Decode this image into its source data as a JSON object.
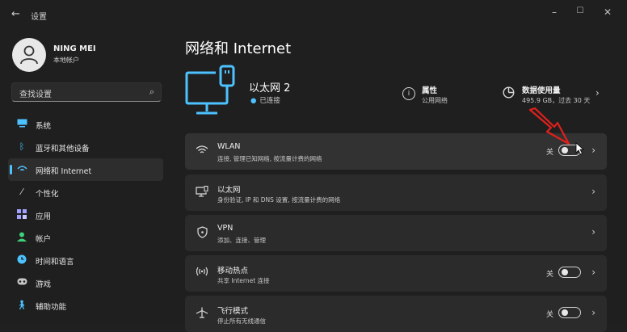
{
  "window": {
    "back_glyph": "←",
    "title": "设置",
    "minimize": "–",
    "maximize": "☐",
    "close": "✕"
  },
  "user": {
    "name": "NING MEI",
    "account_type": "本地帐户"
  },
  "search": {
    "placeholder": "查找设置"
  },
  "sidebar": {
    "items": [
      {
        "label": "系统",
        "icon": "monitor-icon",
        "color": "#4cc2ff"
      },
      {
        "label": "蓝牙和其他设备",
        "icon": "bluetooth-icon",
        "color": "#4cc2ff"
      },
      {
        "label": "网络和 Internet",
        "icon": "network-icon",
        "color": "#4cc2ff",
        "active": true
      },
      {
        "label": "个性化",
        "icon": "brush-icon",
        "color": "#d8d8d8"
      },
      {
        "label": "应用",
        "icon": "apps-icon",
        "color": "#a0a0ff"
      },
      {
        "label": "帐户",
        "icon": "person-icon",
        "color": "#3ed07a"
      },
      {
        "label": "时间和语言",
        "icon": "globe-clock-icon",
        "color": "#4cc2ff"
      },
      {
        "label": "游戏",
        "icon": "gamepad-icon",
        "color": "#c8c8c8"
      },
      {
        "label": "辅助功能",
        "icon": "accessibility-icon",
        "color": "#4cc2ff"
      }
    ]
  },
  "main": {
    "title": "网络和 Internet",
    "ethernet": {
      "name": "以太网 2",
      "status": "已连接"
    },
    "properties": {
      "title": "属性",
      "subtitle": "公用网络"
    },
    "data_usage": {
      "title": "数据使用量",
      "subtitle": "495.9 GB，过去 30 天"
    },
    "cards": [
      {
        "title": "WLAN",
        "subtitle": "连接, 管理已知网络, 按流量计费的网络",
        "icon": "wifi-icon",
        "toggle": "关"
      },
      {
        "title": "以太网",
        "subtitle": "身份验证, IP 和 DNS 设置, 按流量计费的网络",
        "icon": "ethernet-icon"
      },
      {
        "title": "VPN",
        "subtitle": "添加、连接、管理",
        "icon": "shield-icon"
      },
      {
        "title": "移动热点",
        "subtitle": "共享 Internet 连接",
        "icon": "hotspot-icon",
        "toggle": "关"
      },
      {
        "title": "飞行模式",
        "subtitle": "停止所有无线通信",
        "icon": "airplane-icon",
        "toggle": "关"
      }
    ]
  },
  "colors": {
    "accent": "#4cc2ff",
    "annotation_arrow": "#e0201c"
  }
}
